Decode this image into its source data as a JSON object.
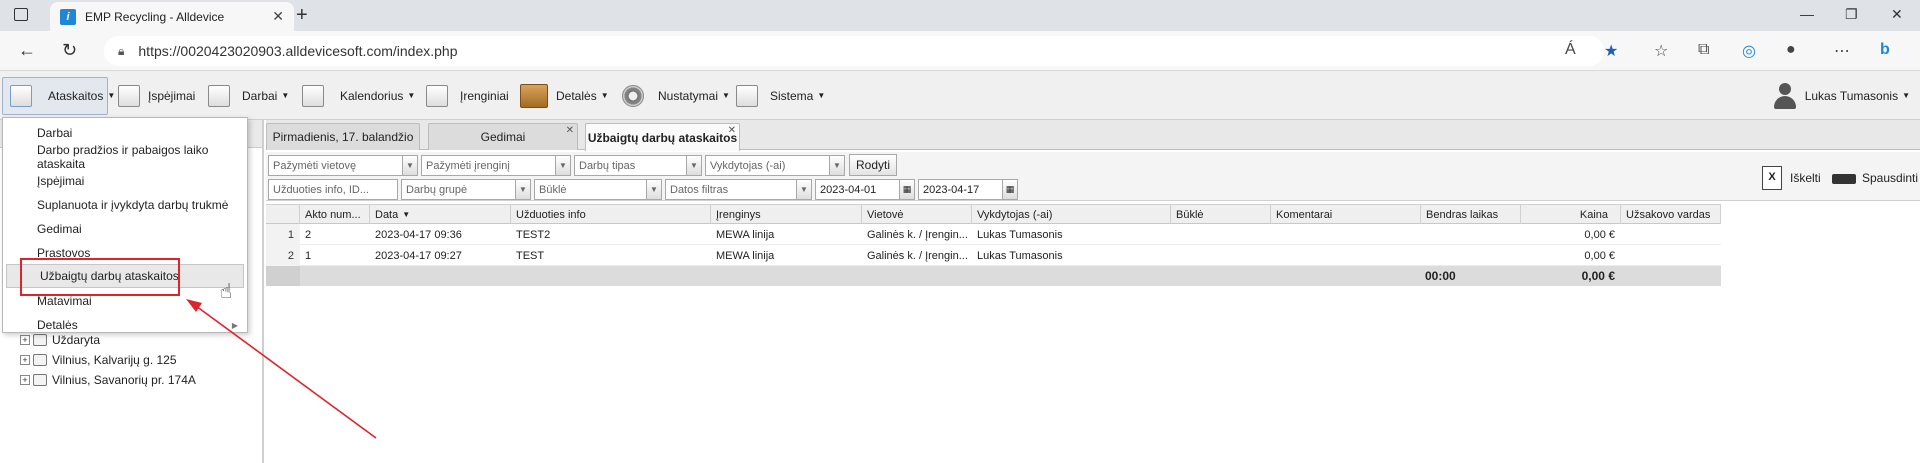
{
  "browser": {
    "tab_title": "EMP Recycling - Alldevice",
    "favicon_letter": "i",
    "url": "https://0020423020903.alldevicesoft.com/index.php",
    "read_aloud": "Á"
  },
  "toolbar": {
    "items": [
      {
        "label": "Ataskaitos"
      },
      {
        "label": "Įspėjimai"
      },
      {
        "label": "Darbai"
      },
      {
        "label": "Kalendorius"
      },
      {
        "label": "Įrenginiai"
      },
      {
        "label": "Detalės"
      },
      {
        "label": "Nustatymai"
      },
      {
        "label": "Sistema"
      }
    ],
    "user_name": "Lukas Tumasonis"
  },
  "dropdown": {
    "items": [
      {
        "label": "Darbai"
      },
      {
        "label": "Darbo pradžios ir pabaigos laiko ataskaita"
      },
      {
        "label": "Įspėjimai"
      },
      {
        "label": "Suplanuota ir įvykdyta darbų trukmė"
      },
      {
        "label": "Gedimai"
      },
      {
        "label": "Prastovos"
      },
      {
        "label": "Užbaigtų darbų ataskaitos"
      },
      {
        "label": "Matavimai"
      },
      {
        "label": "Detalės"
      }
    ]
  },
  "tree": {
    "items": [
      {
        "label": "Uždaryta"
      },
      {
        "label": "Vilnius, Kalvarijų g. 125"
      },
      {
        "label": "Vilnius, Savanorių pr. 174A"
      }
    ]
  },
  "content_tabs": [
    {
      "label": "Pirmadienis, 17. balandžio"
    },
    {
      "label": "Gedimai"
    },
    {
      "label": "Užbaigtų darbų ataskaitos"
    }
  ],
  "filters": {
    "location_placeholder": "Pažymėti vietovę",
    "device_placeholder": "Pažymėti įrenginį",
    "work_type_placeholder": "Darbų tipas",
    "executor_placeholder": "Vykdytojas (-ai)",
    "show_button": "Rodyti",
    "task_info_placeholder": "Užduoties info, ID...",
    "work_group_placeholder": "Darbų grupė",
    "status_placeholder": "Būklė",
    "date_filter_placeholder": "Datos filtras",
    "date_from": "2023-04-01",
    "date_to": "2023-04-17",
    "export_label": "Iškelti",
    "print_label": "Spausdinti"
  },
  "grid": {
    "columns": [
      "",
      "Akto num...",
      "Data",
      "Užduoties info",
      "Įrenginys",
      "Vietovė",
      "Vykdytojas (-ai)",
      "Būklė",
      "Komentarai",
      "Bendras laikas",
      "Kaina",
      "Užsakovo vardas"
    ],
    "rows": [
      {
        "n": "1",
        "act": "2",
        "date": "2023-04-17 09:36",
        "info": "TEST2",
        "device": "MEWA linija",
        "location": "Galinės k. / Įrengin...",
        "executor": "Lukas Tumasonis",
        "status": "",
        "comments": "",
        "time": "",
        "price": "0,00 €",
        "customer": ""
      },
      {
        "n": "2",
        "act": "1",
        "date": "2023-04-17 09:27",
        "info": "TEST",
        "device": "MEWA linija",
        "location": "Galinės k. / Įrengin...",
        "executor": "Lukas Tumasonis",
        "status": "",
        "comments": "",
        "time": "",
        "price": "0,00 €",
        "customer": ""
      }
    ],
    "total_time": "00:00",
    "total_price": "0,00 €"
  },
  "colors": {
    "annotation_red": "#e0232a",
    "edge_blue": "#1e88d6"
  }
}
